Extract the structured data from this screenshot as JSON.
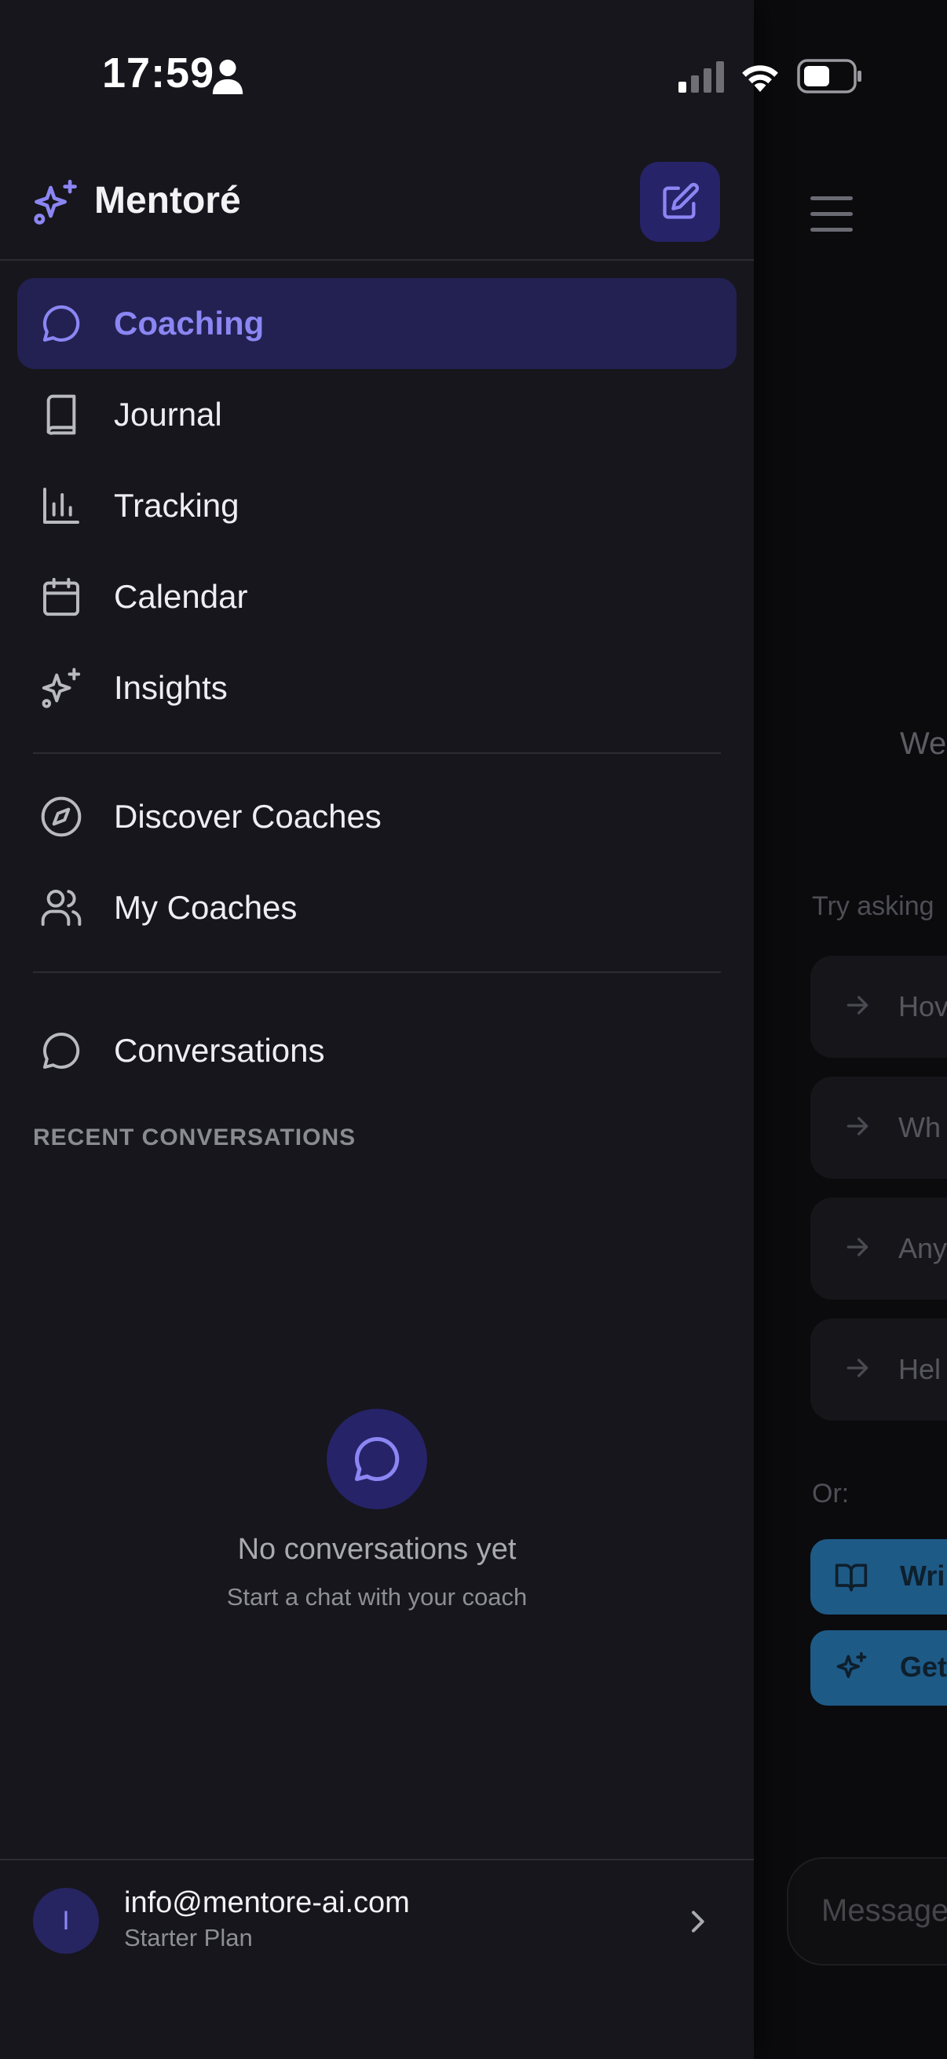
{
  "status_bar": {
    "time": "17:59"
  },
  "app": {
    "name": "Mentoré"
  },
  "nav": {
    "primary": [
      {
        "label": "Coaching",
        "icon": "chat-bubble-icon",
        "active": true
      },
      {
        "label": "Journal",
        "icon": "book-icon"
      },
      {
        "label": "Tracking",
        "icon": "bar-chart-icon"
      },
      {
        "label": "Calendar",
        "icon": "calendar-icon"
      },
      {
        "label": "Insights",
        "icon": "sparkles-icon"
      }
    ],
    "secondary": [
      {
        "label": "Discover Coaches",
        "icon": "compass-icon"
      },
      {
        "label": "My Coaches",
        "icon": "users-icon"
      }
    ],
    "tertiary": [
      {
        "label": "Conversations",
        "icon": "chat-bubble-icon"
      }
    ]
  },
  "recent": {
    "section_label": "RECENT CONVERSATIONS",
    "empty_title": "No conversations yet",
    "empty_subtitle": "Start a chat with your coach"
  },
  "user": {
    "avatar_initial": "I",
    "email": "info@mentore-ai.com",
    "plan": "Starter Plan"
  },
  "main_peek": {
    "welcome": "We",
    "try_asking": "Try asking",
    "suggestions": [
      "Hov",
      "Wh",
      "Any",
      "Hel"
    ],
    "or_label": "Or:",
    "actions": [
      "Wri",
      "Get"
    ],
    "message_placeholder": "Message"
  },
  "colors": {
    "accent": "#8b86f3",
    "active_bg": "#222152",
    "drawer_bg": "#16161c",
    "action_button": "#1e5a86"
  }
}
